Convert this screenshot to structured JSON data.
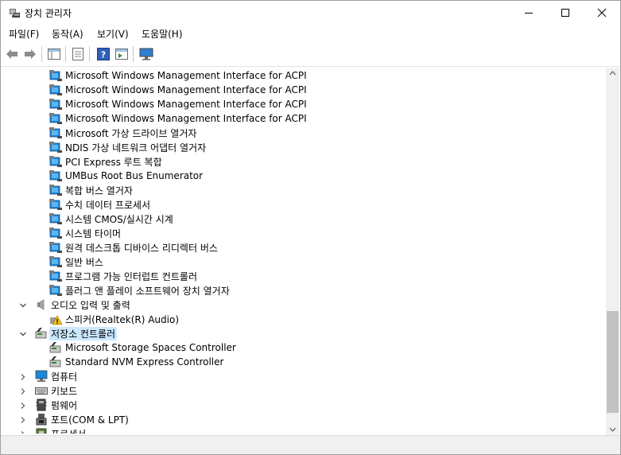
{
  "window": {
    "title": "장치 관리자"
  },
  "menu": [
    {
      "label": "파일(F)"
    },
    {
      "label": "동작(A)"
    },
    {
      "label": "보기(V)"
    },
    {
      "label": "도움말(H)"
    }
  ],
  "toolbar": {
    "icons": [
      "back-icon",
      "forward-icon",
      "properties-view-icon",
      "document-icon",
      "help-icon",
      "run-icon",
      "monitor-icon"
    ]
  },
  "tree": {
    "system_devices": [
      "Microsoft Windows Management Interface for ACPI",
      "Microsoft Windows Management Interface for ACPI",
      "Microsoft Windows Management Interface for ACPI",
      "Microsoft Windows Management Interface for ACPI",
      "Microsoft 가상 드라이브 열거자",
      "NDIS 가상 네트워크 어댑터 열거자",
      "PCI Express 루트 복합",
      "UMBus Root Bus Enumerator",
      "복합 버스 열거자",
      "수치 데이터 프로세서",
      "시스템 CMOS/실시간 시계",
      "시스템 타이머",
      "원격 데스크톱 디바이스 리디렉터 버스",
      "일반 버스",
      "프로그램 가능 인터럽트 컨트롤러",
      "플러그 앤 플레이 소프트웨어 장치 열거자"
    ],
    "audio_category": "오디오 입력 및 출력",
    "audio_devices": [
      "스피커(Realtek(R) Audio)"
    ],
    "storage_category": "저장소 컨트롤러",
    "storage_devices": [
      "Microsoft Storage Spaces Controller",
      "Standard NVM Express Controller"
    ],
    "collapsed_categories": [
      {
        "label": "컴퓨터",
        "icon": "computer-icon"
      },
      {
        "label": "키보드",
        "icon": "keyboard-icon"
      },
      {
        "label": "펌웨어",
        "icon": "firmware-icon"
      },
      {
        "label": "포트(COM & LPT)",
        "icon": "port-icon"
      },
      {
        "label": "프로세서",
        "icon": "processor-icon"
      }
    ]
  },
  "colors": {
    "selection": "#cce8ff",
    "device_icon": "#1c86d8"
  }
}
